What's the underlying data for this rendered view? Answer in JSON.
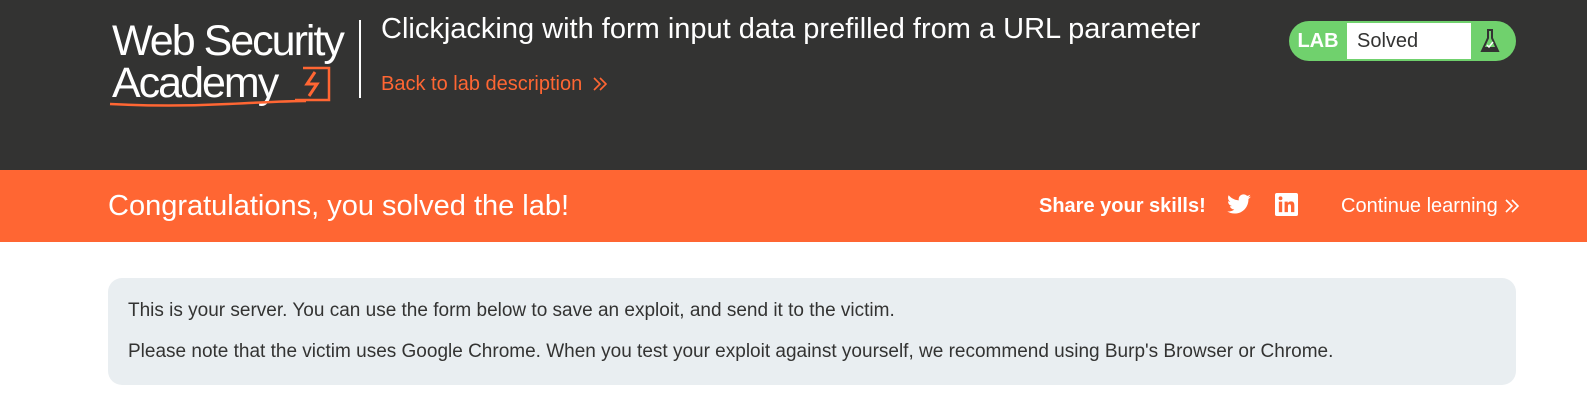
{
  "header": {
    "logo": {
      "line1": "Web Security",
      "line2": "Academy"
    },
    "lab_title": "Clickjacking with form input data prefilled from a URL parameter",
    "back_link": "Back to lab description",
    "back_icon": "double-chevron-right-icon",
    "lab_status": {
      "badge": "LAB",
      "state": "Solved",
      "icon": "flask-icon"
    }
  },
  "banner": {
    "message": "Congratulations, you solved the lab!",
    "share_label": "Share your skills!",
    "social_icons": [
      "twitter-icon",
      "linkedin-icon"
    ],
    "continue_label": "Continue learning",
    "continue_icon": "double-chevron-right-icon"
  },
  "info": {
    "line1": "This is your server. You can use the form below to save an exploit, and send it to the victim.",
    "line2": "Please note that the victim uses Google Chrome. When you test your exploit against yourself, we recommend using Burp's Browser or Chrome."
  },
  "colors": {
    "header_bg": "#333332",
    "accent": "#ff6633",
    "solved_green": "#70d16d",
    "info_bg": "#e9eef1",
    "text": "#333332"
  }
}
